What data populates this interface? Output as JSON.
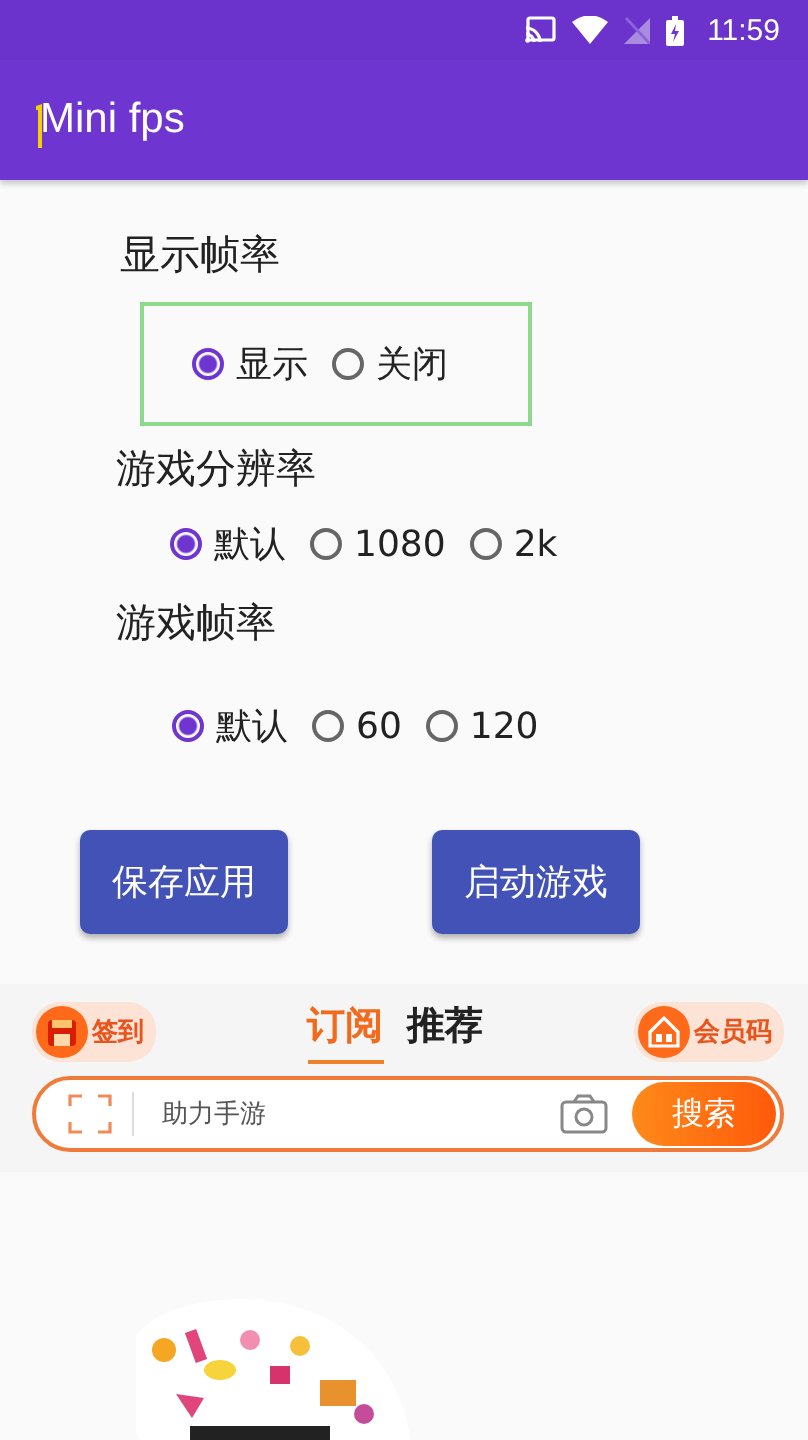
{
  "status_bar": {
    "time": "11:59"
  },
  "app_bar": {
    "title": "Mini fps"
  },
  "groups": [
    {
      "label": "显示帧率",
      "highlighted": true,
      "options": [
        {
          "label": "显示",
          "selected": true
        },
        {
          "label": "关闭",
          "selected": false
        }
      ]
    },
    {
      "label": "游戏分辨率",
      "highlighted": false,
      "options": [
        {
          "label": "默认",
          "selected": true
        },
        {
          "label": "1080",
          "selected": false
        },
        {
          "label": "2k",
          "selected": false
        }
      ]
    },
    {
      "label": "游戏帧率",
      "highlighted": false,
      "options": [
        {
          "label": "默认",
          "selected": true
        },
        {
          "label": "60",
          "selected": false
        },
        {
          "label": "120",
          "selected": false
        }
      ]
    }
  ],
  "buttons": [
    "保存应用",
    "启动游戏"
  ],
  "banner": {
    "left_badge": "签到",
    "tabs": [
      {
        "label": "订阅",
        "selected": true
      },
      {
        "label": "推荐",
        "selected": false
      }
    ],
    "right_badge": "会员码",
    "search": {
      "placeholder": "助力手游",
      "button": "搜索"
    }
  },
  "media": {
    "kind": "picture"
  }
}
